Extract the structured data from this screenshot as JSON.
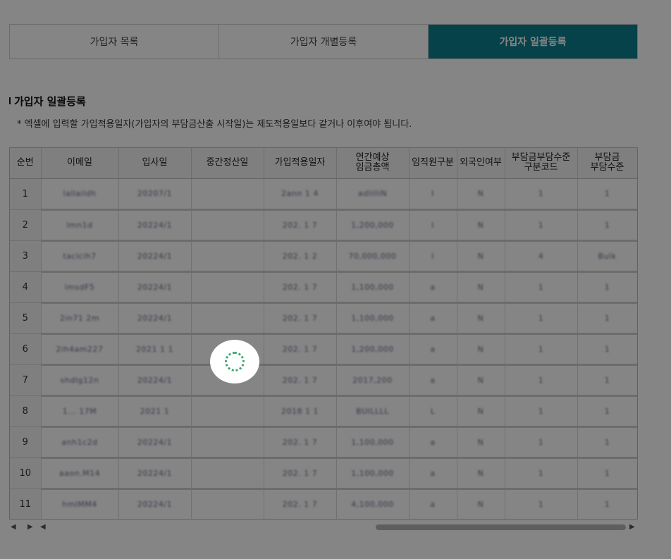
{
  "tabs": [
    {
      "label": "가입자 목록",
      "active": false
    },
    {
      "label": "가입자 개별등록",
      "active": false
    },
    {
      "label": "가입자 일괄등록",
      "active": true
    }
  ],
  "section": {
    "title": "가입자 일괄등록",
    "note": "* 엑셀에 입력할 가입적용일자(가입자의 부담금산출 시작일)는 제도적용일보다 같거나 이후여야 됩니다."
  },
  "grid": {
    "headers": {
      "seq": "순번",
      "email": "이메일",
      "hire_date": "입사일",
      "mid_settlement": "중간정산일",
      "join_date": "가입적용일자",
      "annual_wage_1": "연간예상",
      "annual_wage_2": "임금총액",
      "executive": "임직원구분",
      "foreigner": "외국인여부",
      "burden_code_1": "부담금부담수준",
      "burden_code_2": "구분코드",
      "burden_level_1": "부담금",
      "burden_level_2": "부담수준"
    },
    "rows": [
      {
        "seq": "1",
        "email": "lallaildh",
        "hire": "20207/1",
        "mid": "",
        "join": "2ann 1 4",
        "wage": "adlilliN",
        "exec": "I",
        "foreign": "N",
        "code": "1",
        "level": "1"
      },
      {
        "seq": "2",
        "email": "lmn1d",
        "hire": "20224/1",
        "mid": "",
        "join": "202. 1 7",
        "wage": "1,200,000",
        "exec": "I",
        "foreign": "N",
        "code": "1",
        "level": "1"
      },
      {
        "seq": "3",
        "email": "taclcih7",
        "hire": "20224/1",
        "mid": "",
        "join": "202. 1 2",
        "wage": "70,000,000",
        "exec": "I",
        "foreign": "N",
        "code": "4",
        "level": "Bulk"
      },
      {
        "seq": "4",
        "email": "imsdF5",
        "hire": "20224/1",
        "mid": "",
        "join": "202. 1 7",
        "wage": "1,100,000",
        "exec": "a",
        "foreign": "N",
        "code": "1",
        "level": "1"
      },
      {
        "seq": "5",
        "email": "2in71 2m",
        "hire": "20224/1",
        "mid": "",
        "join": "202. 1 7",
        "wage": "1,100,000",
        "exec": "a",
        "foreign": "N",
        "code": "1",
        "level": "1"
      },
      {
        "seq": "6",
        "email": "2ih4am227",
        "hire": "2021 1 1",
        "mid": "",
        "join": "202. 1 7",
        "wage": "1,200,000",
        "exec": "a",
        "foreign": "N",
        "code": "1",
        "level": "1"
      },
      {
        "seq": "7",
        "email": "shdlg12n",
        "hire": "20224/1",
        "mid": "",
        "join": "202. 1 7",
        "wage": "2017,200",
        "exec": "a",
        "foreign": "N",
        "code": "1",
        "level": "1"
      },
      {
        "seq": "8",
        "email": "1... 17M",
        "hire": "2021 1",
        "mid": "",
        "join": "2018 1 1",
        "wage": "BUILLLL",
        "exec": "L",
        "foreign": "N",
        "code": "1",
        "level": "1"
      },
      {
        "seq": "9",
        "email": "anh1c2d",
        "hire": "20224/1",
        "mid": "",
        "join": "202. 1 7",
        "wage": "1,100,000",
        "exec": "a",
        "foreign": "N",
        "code": "1",
        "level": "1"
      },
      {
        "seq": "10",
        "email": "aaon.M14",
        "hire": "20224/1",
        "mid": "",
        "join": "202. 1 7",
        "wage": "1,100,000",
        "exec": "a",
        "foreign": "N",
        "code": "1",
        "level": "1"
      },
      {
        "seq": "11",
        "email": "hmlMM4",
        "hire": "20224/1",
        "mid": "",
        "join": "202. 1 7",
        "wage": "4,100,000",
        "exec": "a",
        "foreign": "N",
        "code": "1",
        "level": "1"
      }
    ]
  },
  "scroll": {
    "left_arrow": "◀",
    "right_arrow": "▶"
  },
  "colors": {
    "active_tab": "#0a7f8c",
    "spinner": "#3aa66d",
    "overlay": "rgba(0,0,0,0.48)"
  }
}
